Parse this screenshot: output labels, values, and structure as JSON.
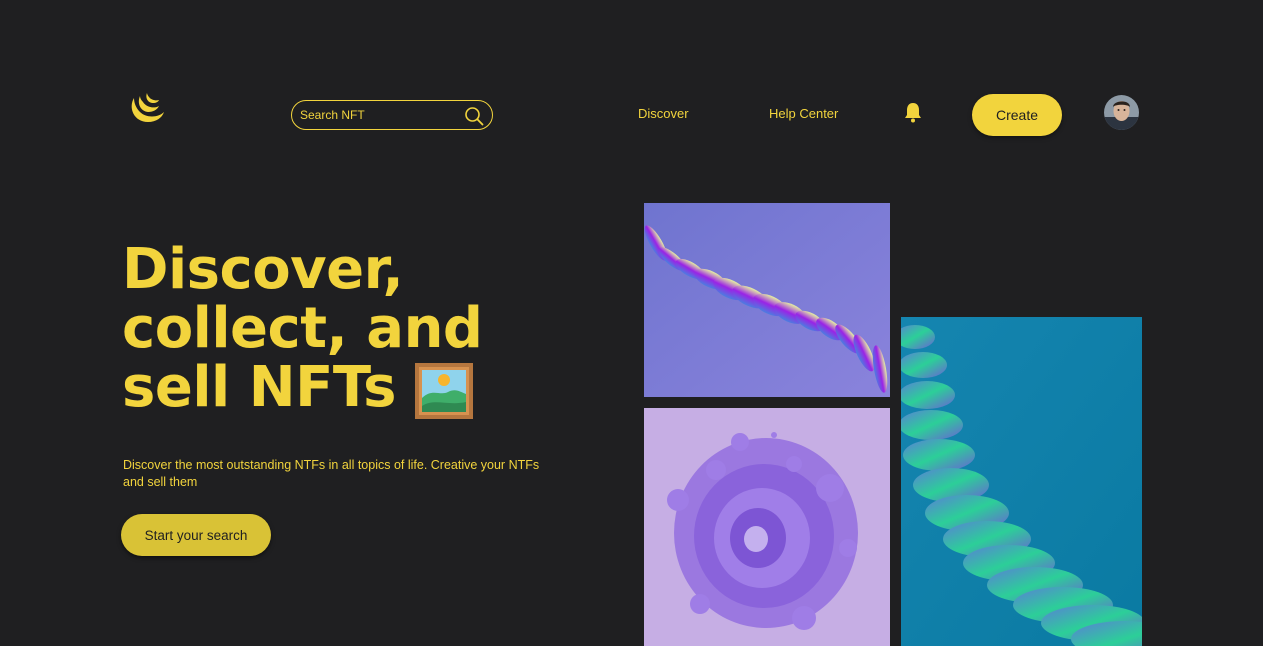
{
  "header": {
    "search": {
      "placeholder": "Search NFT",
      "icon": "search-icon"
    },
    "nav": [
      {
        "label": "Discover"
      },
      {
        "label": "Help Center"
      }
    ],
    "notification_icon": "bell-icon",
    "create_label": "Create",
    "logo_icon": "crescent-moon-logo"
  },
  "hero": {
    "title_lines": [
      "Discover,",
      "collect, and",
      "sell NFTs"
    ],
    "title_icon": "framed-picture-icon",
    "subtitle": "Discover the most outstanding NTFs in all topics of life. Creative your NTFs and sell them",
    "cta_label": "Start your search"
  },
  "colors": {
    "background": "#1f1f21",
    "accent": "#f2d43d",
    "cta": "#d9c236"
  }
}
